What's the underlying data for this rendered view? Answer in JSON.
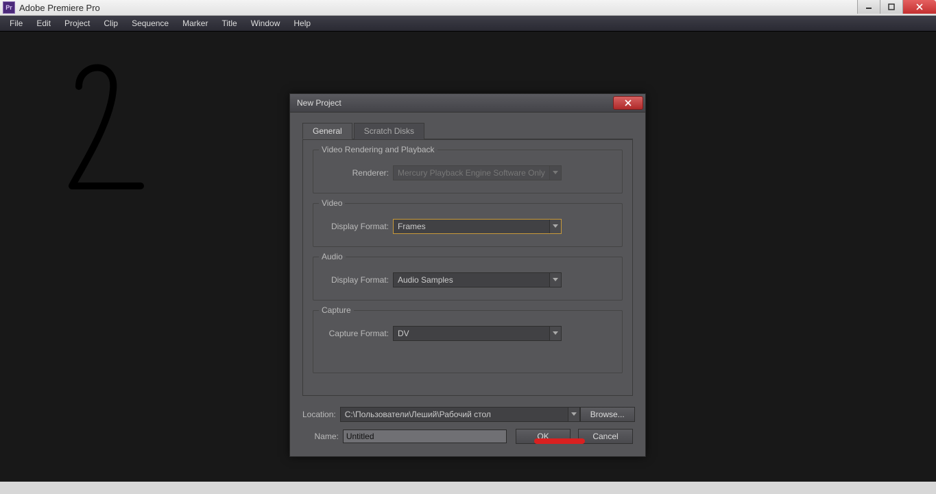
{
  "window": {
    "title": "Adobe Premiere Pro"
  },
  "menubar": [
    "File",
    "Edit",
    "Project",
    "Clip",
    "Sequence",
    "Marker",
    "Title",
    "Window",
    "Help"
  ],
  "dialog": {
    "title": "New Project",
    "tabs": {
      "general": "General",
      "scratch": "Scratch Disks"
    },
    "sections": {
      "vrp": {
        "legend": "Video Rendering and Playback",
        "renderer_label": "Renderer:",
        "renderer_value": "Mercury Playback Engine Software Only"
      },
      "video": {
        "legend": "Video",
        "display_format_label": "Display Format:",
        "display_format_value": "Frames"
      },
      "audio": {
        "legend": "Audio",
        "display_format_label": "Display Format:",
        "display_format_value": "Audio Samples"
      },
      "capture": {
        "legend": "Capture",
        "capture_format_label": "Capture Format:",
        "capture_format_value": "DV"
      }
    },
    "location": {
      "label": "Location:",
      "value": "C:\\Пользователи\\Леший\\Рабочий стол",
      "browse": "Browse..."
    },
    "name": {
      "label": "Name:",
      "value": "Untitled"
    },
    "buttons": {
      "ok": "OK",
      "cancel": "Cancel"
    }
  },
  "annotation": {
    "mark": "2"
  }
}
